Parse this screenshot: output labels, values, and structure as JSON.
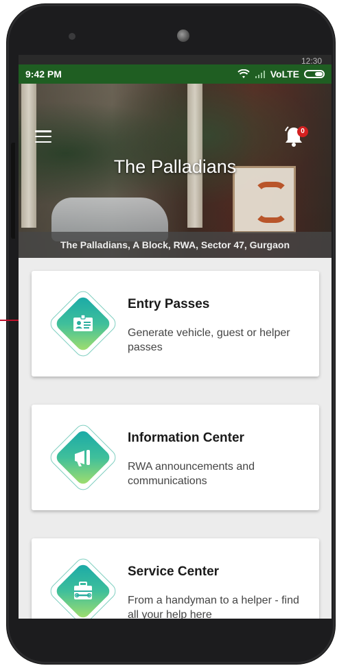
{
  "status_bar": {
    "time": "9:42 PM",
    "network": "VoLTE",
    "ghost_time": "12:30"
  },
  "header": {
    "title": "The Palladians",
    "subtitle": "The Palladians, A Block, RWA, Sector 47, Gurgaon",
    "notification_count": "0"
  },
  "cards": [
    {
      "title": "Entry Passes",
      "description": "Generate vehicle, guest or helper passes",
      "icon": "id-card-icon"
    },
    {
      "title": "Information Center",
      "description": "RWA announcements and communications",
      "icon": "megaphone-icon"
    },
    {
      "title": "Service Center",
      "description": "From a handyman to a helper - find all your help here",
      "icon": "toolbox-icon"
    }
  ],
  "colors": {
    "status_bar": "#1f5e22",
    "badge": "#d32020",
    "accent_gradient_start": "#18a8a8",
    "accent_gradient_end": "#a8e06a",
    "pointer": "#c0102b"
  }
}
